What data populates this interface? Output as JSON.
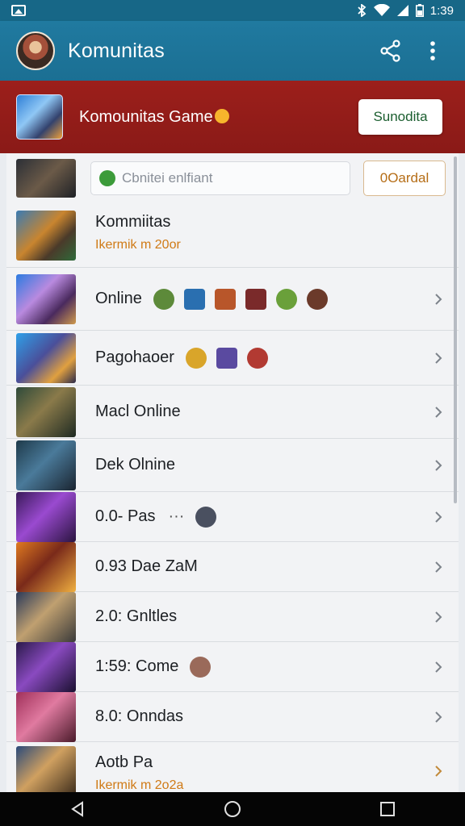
{
  "status_bar": {
    "time": "1:39"
  },
  "app_bar": {
    "title": "Komunitas"
  },
  "banner": {
    "title": "Komounitas Game",
    "button": "Sunodita"
  },
  "compose": {
    "placeholder": "Cbnitei enlfiant",
    "button": "0Oardal"
  },
  "rows": [
    {
      "title": "Kommiitas",
      "subtitle": "Ikermik m 20or"
    },
    {
      "title": "Online"
    },
    {
      "title": "Pagohaoer"
    },
    {
      "title": "Macl Online"
    },
    {
      "title": "Dek Olnine"
    },
    {
      "title": "0.0- Pas",
      "extra": "···"
    },
    {
      "title": "0.93 Dae ZaM"
    },
    {
      "title": "2.0: Gnltles"
    },
    {
      "title": "1:59: Come"
    },
    {
      "title": "8.0: Onndas"
    },
    {
      "title": "Aotb Pa",
      "subtitle": "Ikermik m 2o2a"
    }
  ],
  "colors": {
    "app_bar": "#1f77a0",
    "banner": "#951d19",
    "accent_orange": "#d07a16"
  }
}
